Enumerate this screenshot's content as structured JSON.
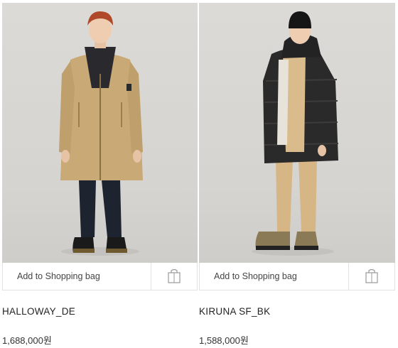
{
  "products": [
    {
      "name": "HALLOWAY_DE",
      "price": "1,688,000원",
      "add_label": "Add to Shopping bag",
      "image_icon": "model-long-beige-parka",
      "bag_icon": "shopping-bag-icon",
      "background": "#d8d6d2"
    },
    {
      "name": "KIRUNA SF_BK",
      "price": "1,588,000원",
      "add_label": "Add to Shopping bag",
      "image_icon": "model-black-puffer-coat",
      "bag_icon": "shopping-bag-icon",
      "background": "#d8d6d2"
    }
  ]
}
